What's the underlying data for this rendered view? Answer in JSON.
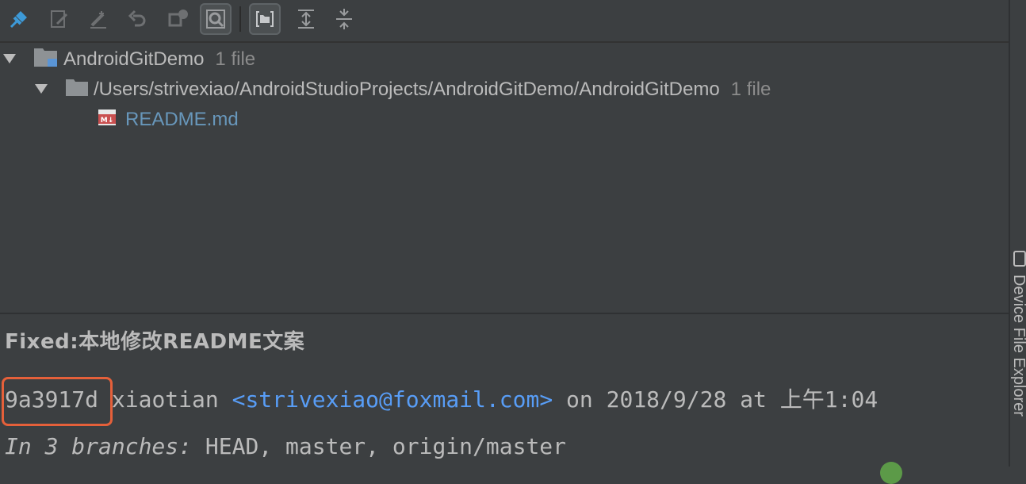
{
  "toolbar": {
    "buttons": [
      {
        "icon": "pin-icon"
      },
      {
        "icon": "edit-source-icon"
      },
      {
        "icon": "edit-icon"
      },
      {
        "icon": "revert-icon"
      },
      {
        "icon": "compare-icon"
      },
      {
        "icon": "search-preview-icon"
      },
      {
        "icon": "group-by-directory-icon"
      },
      {
        "icon": "expand-all-icon"
      },
      {
        "icon": "collapse-all-icon"
      }
    ]
  },
  "tree": {
    "root": {
      "label": "AndroidGitDemo",
      "count": "1 file"
    },
    "folder": {
      "label": "/Users/strivexiao/AndroidStudioProjects/AndroidGitDemo/AndroidGitDemo",
      "count": "1 file"
    },
    "file": {
      "label": "README.md",
      "icon": "markdown-file-icon"
    }
  },
  "commit": {
    "subject": "Fixed:本地修改README文案",
    "hash": "9a3917d",
    "author": "xiaotian",
    "email": "<strivexiao@foxmail.com>",
    "date_text": "on 2018/9/28 at 上午1:04",
    "branches_label": "In 3 branches:",
    "branches": "HEAD, master, origin/master"
  },
  "side_panel": {
    "label": "Device File Explorer"
  },
  "colors": {
    "background": "#3c3f41",
    "link": "#589df6",
    "file": "#6897bb",
    "highlight": "#e5603a"
  }
}
